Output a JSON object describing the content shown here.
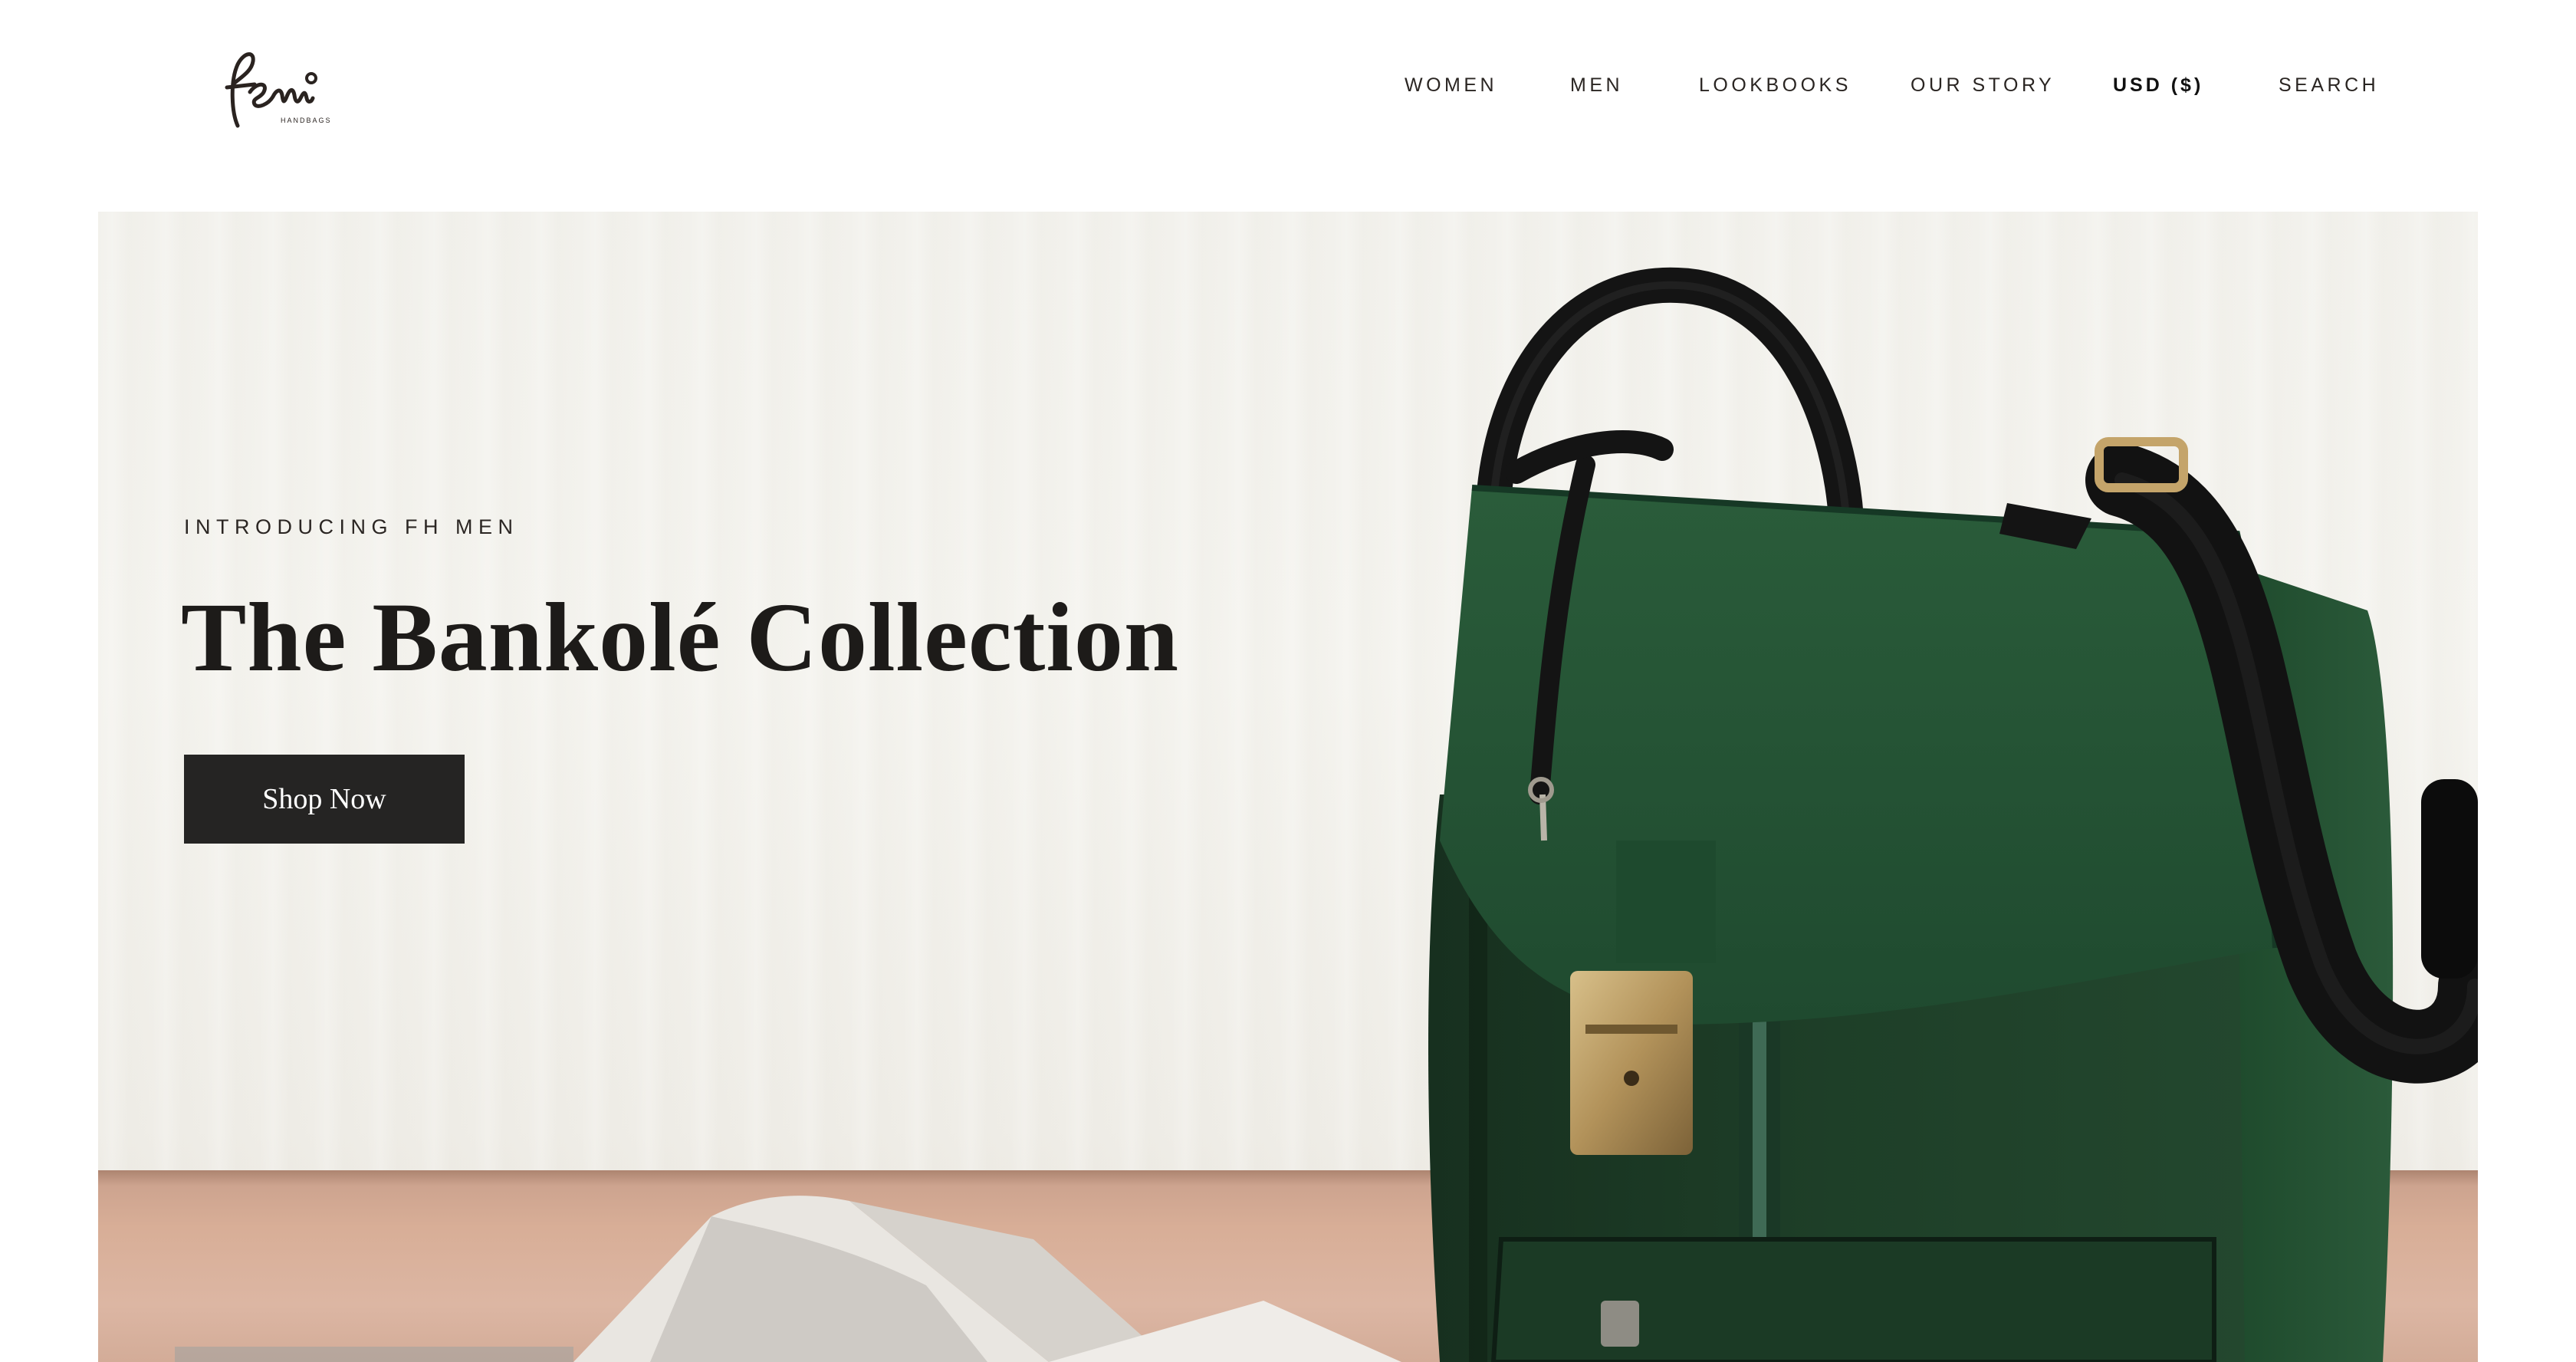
{
  "brand": {
    "logo_text": "femi",
    "logo_subtext": "HANDBAGS"
  },
  "nav": {
    "items": [
      {
        "label": "WOMEN"
      },
      {
        "label": "MEN"
      },
      {
        "label": "LOOKBOOKS"
      },
      {
        "label": "OUR STORY"
      },
      {
        "label": "USD ($)"
      },
      {
        "label": "SEARCH"
      }
    ]
  },
  "hero": {
    "eyebrow": "INTRODUCING FH MEN",
    "title": "The Bankolé Collection",
    "cta_label": "Shop Now",
    "image_subject": "green leather briefcase with black strap on wooden table"
  },
  "colors": {
    "cta_bg": "#252423",
    "text_dark": "#1d1b19",
    "bag_green": "#1f4a2f",
    "table_wood": "#d8ae97"
  }
}
